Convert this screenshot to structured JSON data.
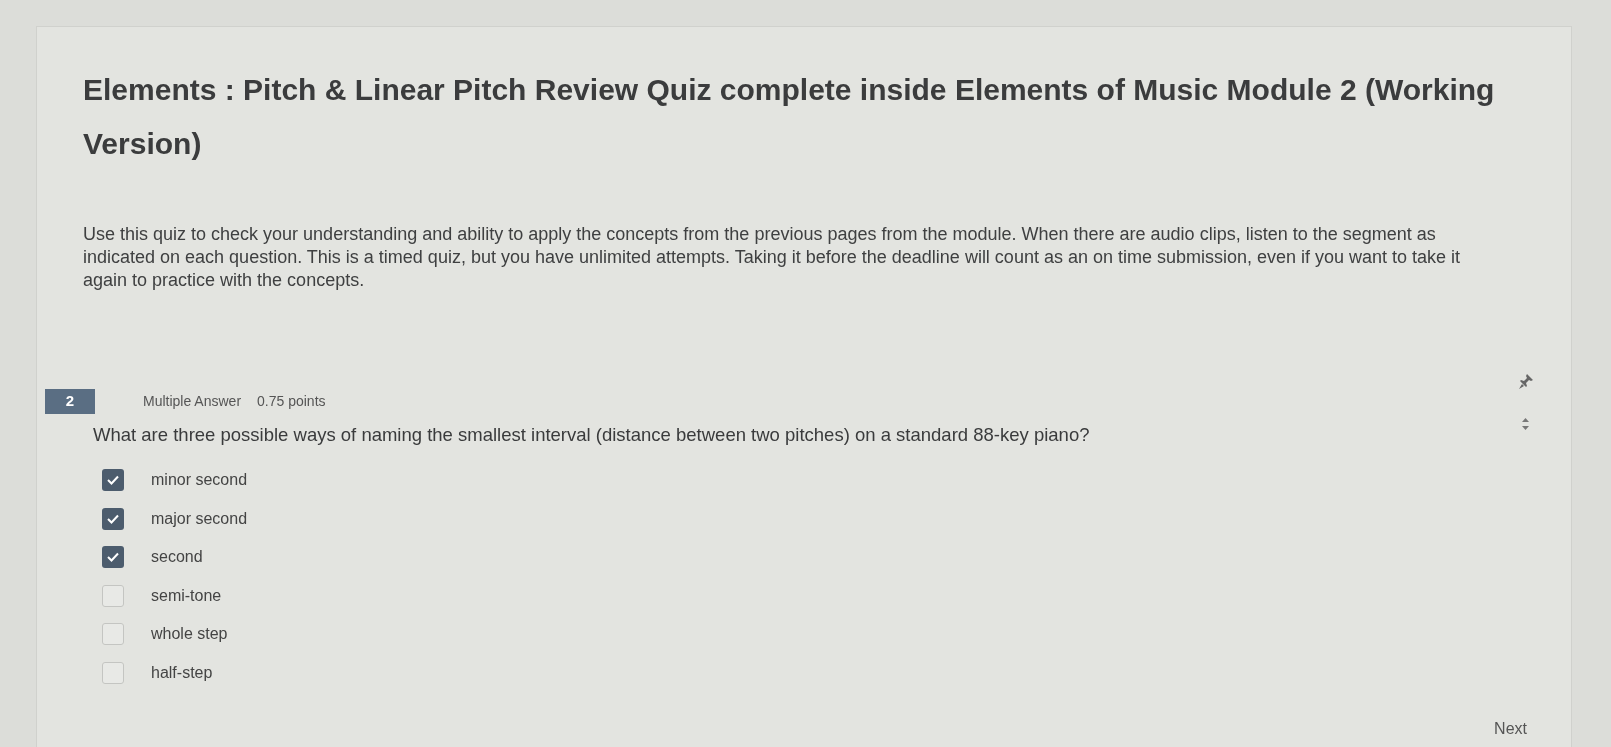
{
  "title": "Elements : Pitch & Linear Pitch Review Quiz complete inside Elements of Music Module 2 (Working Version)",
  "instructions": "Use this quiz to check your understanding and ability to apply the concepts from the previous pages from the module. When there are audio clips, listen to the segment as indicated on each question. This is a timed quiz, but you have unlimited attempts. Taking it before the deadline will count as an on time submission, even if you want to take it again to practice with the concepts.",
  "question": {
    "number": "2",
    "type": "Multiple Answer",
    "points": "0.75 points",
    "text": "What are three possible ways of naming the smallest interval (distance between two pitches) on a standard 88-key piano?",
    "options": [
      {
        "label": "minor second",
        "checked": true
      },
      {
        "label": "major second",
        "checked": true
      },
      {
        "label": "second",
        "checked": true
      },
      {
        "label": "semi-tone",
        "checked": false
      },
      {
        "label": "whole step",
        "checked": false
      },
      {
        "label": "half-step",
        "checked": false
      }
    ]
  },
  "next_button": "Next"
}
